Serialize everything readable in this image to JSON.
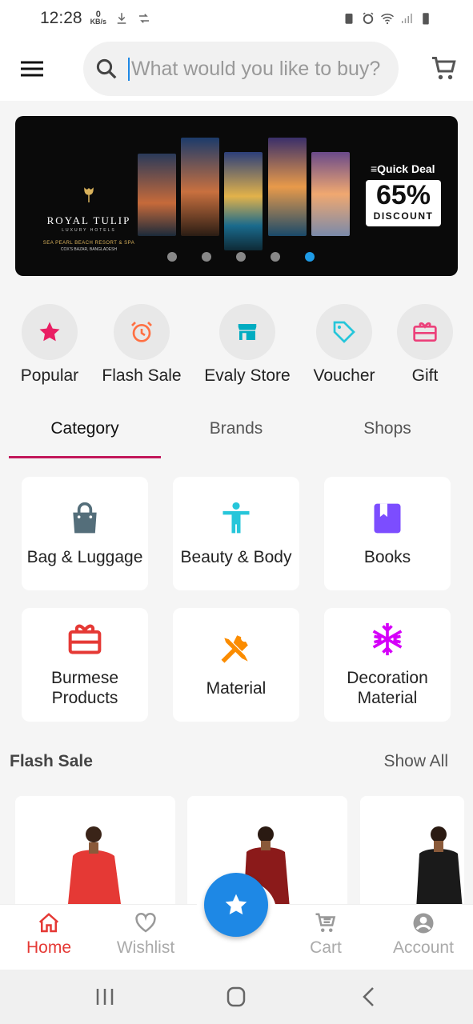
{
  "status_bar": {
    "time": "12:28",
    "net_speed": "0",
    "net_unit": "KB/s"
  },
  "search": {
    "placeholder": "What would you like to buy?"
  },
  "banner": {
    "brand_name": "ROYAL TULIP",
    "brand_sub": "LUXURY HOTELS",
    "resort": "SEA PEARL BEACH RESORT & SPA",
    "location": "COX'S BAZAR, BANGLADESH",
    "deal_label": "Quick Deal",
    "deal_percent": "65%",
    "deal_text": "DISCOUNT",
    "slide_count": 5,
    "active_slide": 5
  },
  "quick_links": [
    {
      "label": "Popular",
      "icon": "star-icon",
      "color": "#e91e63"
    },
    {
      "label": "Flash Sale",
      "icon": "alarm-clock-icon",
      "color": "#ff7043"
    },
    {
      "label": "Evaly Store",
      "icon": "store-icon",
      "color": "#00acc1"
    },
    {
      "label": "Voucher",
      "icon": "tag-icon",
      "color": "#26c6da"
    },
    {
      "label": "Gift",
      "icon": "gift-card-icon",
      "color": "#ec407a"
    }
  ],
  "tabs": [
    {
      "label": "Category",
      "active": true
    },
    {
      "label": "Brands",
      "active": false
    },
    {
      "label": "Shops",
      "active": false
    }
  ],
  "categories": [
    {
      "label": "Bag & Luggage",
      "icon": "shopping-bag-icon",
      "color": "#546e7a"
    },
    {
      "label": "Beauty & Body",
      "icon": "accessibility-person-icon",
      "color": "#26c6da"
    },
    {
      "label": "Books",
      "icon": "book-icon",
      "color": "#7c4dff"
    },
    {
      "label": "Burmese Products",
      "icon": "gift-card-icon",
      "color": "#e53935"
    },
    {
      "label": "Material",
      "icon": "tools-icon",
      "color": "#fb8c00"
    },
    {
      "label": "Decoration Material",
      "icon": "snowflake-icon",
      "color": "#d500f9"
    }
  ],
  "flash_sale": {
    "title": "Flash Sale",
    "show_all": "Show All"
  },
  "bottom_nav": {
    "home": "Home",
    "wishlist": "Wishlist",
    "cart": "Cart",
    "account": "Account",
    "active_color": "#e53935",
    "fab_color": "#1e88e5"
  }
}
